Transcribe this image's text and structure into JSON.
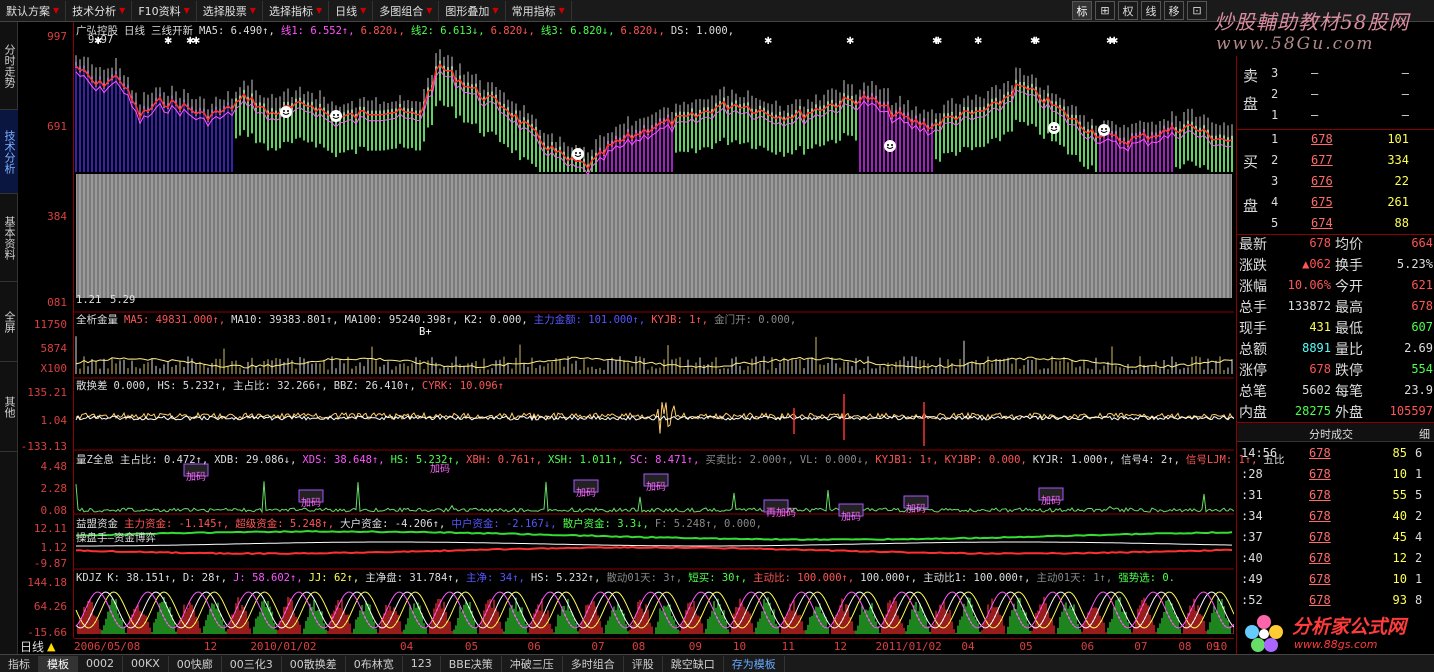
{
  "toolbar": {
    "items": [
      "默认方案",
      "技术分析",
      "F10资料",
      "选择股票",
      "选择指标",
      "日线",
      "多图组合",
      "图形叠加",
      "常用指标"
    ],
    "icons": [
      "标",
      "⊞",
      "权",
      "线",
      "移",
      "⊡"
    ]
  },
  "brand": {
    "line1": "炒股輔助教材58股网",
    "line2": "www.58Gu.com"
  },
  "left_tabs": [
    "分时走势",
    "技术分析",
    "基本资料",
    "全屏",
    "其他"
  ],
  "yaxis": {
    "main": [
      "997",
      "691",
      "384",
      "081"
    ],
    "vol": [
      "11750",
      "5874",
      "X100"
    ],
    "p3": [
      "135.21",
      "1.04",
      "-133.13"
    ],
    "p4": [
      "4.48",
      "2.28",
      "0.08"
    ],
    "p5": [
      "12.11",
      "1.12",
      "-9.87"
    ],
    "p6": [
      "144.18",
      "64.26",
      "-15.66"
    ]
  },
  "panels": {
    "main": {
      "title": "广弘控股",
      "period": "日线",
      "indicator": "三线开新",
      "fields": [
        {
          "t": "MA5: 6.490↑,",
          "c": "#ddd"
        },
        {
          "t": "线1: 6.552↑,",
          "c": "#ff55ff"
        },
        {
          "t": "6.820↓,",
          "c": "#ff5555"
        },
        {
          "t": "线2: 6.613↓,",
          "c": "#4cff4c"
        },
        {
          "t": "6.820↓,",
          "c": "#ff5555"
        },
        {
          "t": "线3: 6.820↓,",
          "c": "#4cff4c"
        },
        {
          "t": "6.820↓,",
          "c": "#ff5555"
        },
        {
          "t": "DS: 1.000,",
          "c": "#ddd"
        }
      ],
      "high_mark": "9.97",
      "low_mark": "1.21",
      "low_mark2": "5.29"
    },
    "vol": {
      "title": "全析金量",
      "fields": [
        {
          "t": "MA5: 49831.000↑,",
          "c": "#ff5555"
        },
        {
          "t": "MA10: 39383.801↑,",
          "c": "#ddd"
        },
        {
          "t": "MA100: 95240.398↑,",
          "c": "#ddd"
        },
        {
          "t": "K2: 0.000,",
          "c": "#ddd"
        },
        {
          "t": "主力金额: 101.000↑,",
          "c": "#5555ff"
        },
        {
          "t": "KYJB: 1↑,",
          "c": "#ff5555"
        },
        {
          "t": "金门开: 0.000,",
          "c": "#888"
        }
      ],
      "mark": "B+"
    },
    "p3": {
      "title": "散换差",
      "fields": [
        {
          "t": "0.000,",
          "c": "#ddd"
        },
        {
          "t": "HS: 5.232↑,",
          "c": "#ddd"
        },
        {
          "t": "主占比: 32.266↑,",
          "c": "#ddd"
        },
        {
          "t": "BBZ: 26.410↑,",
          "c": "#ddd"
        },
        {
          "t": "CYRK: 10.096↑",
          "c": "#ff5555"
        }
      ]
    },
    "p4": {
      "title": "量Z全息",
      "fields": [
        {
          "t": "主占比: 0.472↑,",
          "c": "#ddd"
        },
        {
          "t": "XDB: 29.086↓,",
          "c": "#ddd"
        },
        {
          "t": "XDS: 38.648↑,",
          "c": "#ff55ff"
        },
        {
          "t": "HS: 5.232↑,",
          "c": "#4cff4c"
        },
        {
          "t": "XBH: 0.761↑,",
          "c": "#ff5555"
        },
        {
          "t": "XSH: 1.011↑,",
          "c": "#4cff4c"
        },
        {
          "t": "SC: 8.471↑,",
          "c": "#ff55ff"
        },
        {
          "t": "买卖比: 2.000↑,",
          "c": "#888"
        },
        {
          "t": "VL: 0.000↓,",
          "c": "#888"
        },
        {
          "t": "KYJB1: 1↑,",
          "c": "#ff5555"
        },
        {
          "t": "KYJBP: 0.000,",
          "c": "#ff5555"
        },
        {
          "t": "KYJR: 1.000↑,",
          "c": "#ddd"
        },
        {
          "t": "信号4: 2↑,",
          "c": "#ddd"
        },
        {
          "t": "信号LJM: 1↑,",
          "c": "#ff5555"
        },
        {
          "t": "五比",
          "c": "#ddd"
        }
      ],
      "markers": [
        "加码",
        "加码",
        "加码",
        "加码",
        "再加码",
        "加码",
        "加码",
        "加码",
        "加码"
      ]
    },
    "p5": {
      "title": "益盟资金",
      "subtitle": "操盘手—资金博弈",
      "fields": [
        {
          "t": "主力资金: -1.145↑,",
          "c": "#ff5555"
        },
        {
          "t": "超级资金: 5.248↑,",
          "c": "#ff5555"
        },
        {
          "t": "大户资金: -4.206↑,",
          "c": "#ddd"
        },
        {
          "t": "中户资金: -2.167↓,",
          "c": "#5555ff"
        },
        {
          "t": "散户资金: 3.3↓,",
          "c": "#4cff4c"
        },
        {
          "t": "F: 5.248↑,",
          "c": "#888"
        },
        {
          "t": "0.000,",
          "c": "#888"
        }
      ]
    },
    "p6": {
      "title": "KDJZ",
      "fields": [
        {
          "t": "K: 38.151↑,",
          "c": "#ddd"
        },
        {
          "t": "D: 28↑,",
          "c": "#ddd"
        },
        {
          "t": "J: 58.602↑,",
          "c": "#ff55ff"
        },
        {
          "t": "JJ: 62↑,",
          "c": "#ffff55"
        },
        {
          "t": "主净盘: 31.784↑,",
          "c": "#ddd"
        },
        {
          "t": "主净: 34↑,",
          "c": "#5555ff"
        },
        {
          "t": "HS: 5.232↑,",
          "c": "#ddd"
        },
        {
          "t": "散动01天: 3↑,",
          "c": "#888"
        },
        {
          "t": "短买: 30↑,",
          "c": "#4cff4c"
        },
        {
          "t": "主动比: 100.000↑,",
          "c": "#ff5555"
        },
        {
          "t": "100.000↑,",
          "c": "#ddd"
        },
        {
          "t": "主动比1: 100.000↑,",
          "c": "#ddd"
        },
        {
          "t": "主动01天: 1↑,",
          "c": "#888"
        },
        {
          "t": "强势选: 0.",
          "c": "#4cff4c"
        }
      ]
    }
  },
  "dates": [
    {
      "t": "2006/05/08",
      "x": 0.0
    },
    {
      "t": "12",
      "x": 0.112
    },
    {
      "t": "2010/01/02",
      "x": 0.152
    },
    {
      "t": "04",
      "x": 0.281
    },
    {
      "t": "05",
      "x": 0.337
    },
    {
      "t": "06",
      "x": 0.391
    },
    {
      "t": "07",
      "x": 0.446
    },
    {
      "t": "08",
      "x": 0.481
    },
    {
      "t": "09",
      "x": 0.53
    },
    {
      "t": "10",
      "x": 0.568
    },
    {
      "t": "11",
      "x": 0.61
    },
    {
      "t": "12",
      "x": 0.655
    },
    {
      "t": "2011/01/02",
      "x": 0.691
    },
    {
      "t": "04",
      "x": 0.765
    },
    {
      "t": "05",
      "x": 0.815
    },
    {
      "t": "06",
      "x": 0.868
    },
    {
      "t": "07",
      "x": 0.914
    },
    {
      "t": "08",
      "x": 0.952
    },
    {
      "t": "09",
      "x": 0.976
    },
    {
      "t": "10",
      "x": 1.0
    }
  ],
  "dayline": "日线",
  "orderbook": {
    "sell_label": "卖盘",
    "buy_label": "买盘",
    "sell": [
      {
        "lvl": "3",
        "p": "–",
        "v": "–"
      },
      {
        "lvl": "2",
        "p": "–",
        "v": "–"
      },
      {
        "lvl": "1",
        "p": "–",
        "v": "–"
      }
    ],
    "buy": [
      {
        "lvl": "1",
        "p": "678",
        "v": "101"
      },
      {
        "lvl": "2",
        "p": "677",
        "v": "334"
      },
      {
        "lvl": "3",
        "p": "676",
        "v": "22"
      },
      {
        "lvl": "4",
        "p": "675",
        "v": "261"
      },
      {
        "lvl": "5",
        "p": "674",
        "v": "88"
      }
    ]
  },
  "quote": [
    {
      "k": "最新",
      "v": "678",
      "vc": "red",
      "k2": "均价",
      "v2": "664",
      "v2c": "red"
    },
    {
      "k": "涨跌",
      "v": "▲062",
      "vc": "red",
      "k2": "换手",
      "v2": "5.23%",
      "v2c": "wht"
    },
    {
      "k": "涨幅",
      "v": "10.06%",
      "vc": "red",
      "k2": "今开",
      "v2": "621",
      "v2c": "red"
    },
    {
      "k": "总手",
      "v": "133872",
      "vc": "wht",
      "k2": "最高",
      "v2": "678",
      "v2c": "red"
    },
    {
      "k": "现手",
      "v": "431",
      "vc": "yel",
      "k2": "最低",
      "v2": "607",
      "v2c": "grn"
    },
    {
      "k": "总额",
      "v": "8891",
      "vc": "cyn",
      "k2": "量比",
      "v2": "2.69",
      "v2c": "wht"
    },
    {
      "k": "涨停",
      "v": "678",
      "vc": "red",
      "k2": "跌停",
      "v2": "554",
      "v2c": "grn"
    },
    {
      "k": "总笔",
      "v": "5602",
      "vc": "wht",
      "k2": "每笔",
      "v2": "23.9",
      "v2c": "wht"
    },
    {
      "k": "内盘",
      "v": "28275",
      "vc": "grn",
      "k2": "外盘",
      "v2": "105597",
      "v2c": "red"
    }
  ],
  "trades_header": {
    "title": "分时成交",
    "detail": "细"
  },
  "trades": [
    {
      "t": "14:56",
      "p": "678",
      "v": "85",
      "n": "6"
    },
    {
      "t": ":28",
      "p": "678",
      "v": "10",
      "n": "1"
    },
    {
      "t": ":31",
      "p": "678",
      "v": "55",
      "n": "5"
    },
    {
      "t": ":34",
      "p": "678",
      "v": "40",
      "n": "2"
    },
    {
      "t": ":37",
      "p": "678",
      "v": "45",
      "n": "4"
    },
    {
      "t": ":40",
      "p": "678",
      "v": "12",
      "n": "2"
    },
    {
      "t": ":49",
      "p": "678",
      "v": "10",
      "n": "1"
    },
    {
      "t": ":52",
      "p": "678",
      "v": "93",
      "n": "8"
    }
  ],
  "logo2": {
    "line1": "分析家公式网",
    "line2": "www.88gs.com"
  },
  "statusbar": [
    "指标",
    "模板",
    "0002",
    "00KX",
    "00快廊",
    "00三化3",
    "00散换差",
    "0布林宽",
    "123",
    "BBE决策",
    "冲破三压",
    "多时组合",
    "评股",
    "跳空缺口",
    "存为模板"
  ],
  "colors": {
    "up": "#ff5555",
    "down": "#4cff4c",
    "axis": "#8b0000",
    "vol_bar": "#aaaaaa"
  }
}
